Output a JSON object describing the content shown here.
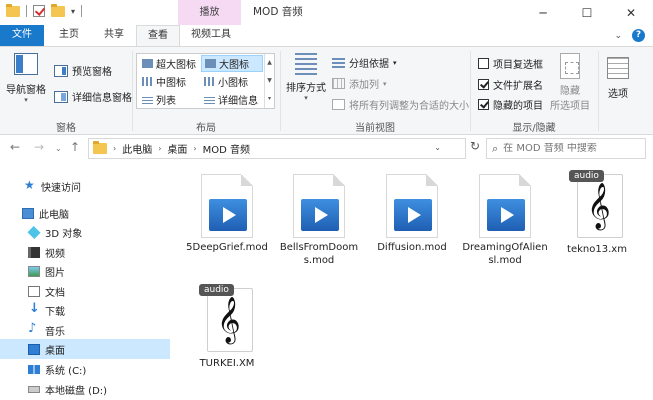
{
  "titlebar": {
    "context_tab": "播放",
    "title": "MOD 音频",
    "controls": {
      "minimize": "─",
      "maximize": "☐",
      "close": "✕"
    }
  },
  "tabs": {
    "file": "文件",
    "home": "主页",
    "share": "共享",
    "view": "查看",
    "video_tools": "视频工具"
  },
  "ribbon": {
    "panes": {
      "label": "窗格",
      "nav_pane": "导航窗格",
      "preview_pane": "预览窗格",
      "details_pane": "详细信息窗格"
    },
    "layout": {
      "label": "布局",
      "items": [
        "超大图标",
        "大图标",
        "中图标",
        "小图标",
        "列表",
        "详细信息"
      ],
      "selected": "大图标"
    },
    "current_view": {
      "label": "当前视图",
      "sort_by": "排序方式",
      "group_by": "分组依据",
      "add_columns": "添加列",
      "size_all_columns": "将所有列调整为合适的大小"
    },
    "show_hide": {
      "label": "显示/隐藏",
      "item_checkboxes": "项目复选框",
      "item_checkboxes_checked": false,
      "file_extensions": "文件扩展名",
      "file_extensions_checked": true,
      "hidden_items": "隐藏的项目",
      "hidden_items_checked": true,
      "hide_selected_line1": "隐藏",
      "hide_selected_line2": "所选项目",
      "options": "选项",
      "highlight_color": "#e02020"
    }
  },
  "address": {
    "crumbs": [
      "此电脑",
      "桌面",
      "MOD 音频"
    ],
    "search_placeholder": "在 MOD 音频 中搜索"
  },
  "nav_pane": {
    "items": [
      {
        "label": "快速访问",
        "icon": "star-icon"
      },
      {
        "label": "此电脑",
        "icon": "computer-icon"
      },
      {
        "label": "3D 对象",
        "icon": "cube-icon"
      },
      {
        "label": "视频",
        "icon": "video-icon"
      },
      {
        "label": "图片",
        "icon": "picture-icon"
      },
      {
        "label": "文档",
        "icon": "document-icon"
      },
      {
        "label": "下载",
        "icon": "download-icon"
      },
      {
        "label": "音乐",
        "icon": "music-icon"
      },
      {
        "label": "桌面",
        "icon": "desktop-icon"
      },
      {
        "label": "系统 (C:)",
        "icon": "system-drive-icon"
      },
      {
        "label": "本地磁盘 (D:)",
        "icon": "drive-icon"
      }
    ],
    "selected": "桌面"
  },
  "files": [
    {
      "name": "5DeepGrief.mod",
      "type": "mod"
    },
    {
      "name": "BellsFromDooms.mod",
      "type": "mod"
    },
    {
      "name": "Diffusion.mod",
      "type": "mod"
    },
    {
      "name": "DreamingOfAliensl.mod",
      "type": "mod"
    },
    {
      "name": "tekno13.xm",
      "type": "audio",
      "tag": "audio"
    },
    {
      "name": "TURKEI.XM",
      "type": "audio",
      "tag": "audio"
    }
  ],
  "colors": {
    "accent": "#1979ca",
    "context_tab": "#f6d9f3",
    "selection": "#cce8ff"
  }
}
